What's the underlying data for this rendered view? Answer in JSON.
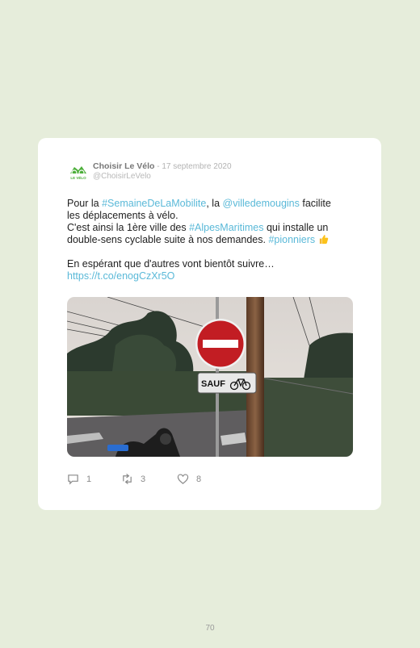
{
  "tweet": {
    "author_name": "Choisir Le Vélo",
    "separator": " - ",
    "date": "17 septembre 2020",
    "handle": "@ChoisirLeVelo",
    "lines": {
      "l1_a": "Pour la ",
      "l1_tag": "#SemaineDeLaMobilite",
      "l1_b": ", la ",
      "l1_mention": "@villedemougins",
      "l1_c": " facilite",
      "l2": "les déplacements à vélo.",
      "l3_a": "C'est ainsi la 1ère ville des ",
      "l3_tag": "#AlpesMaritimes",
      "l3_b": " qui installe un",
      "l4_a": "double-sens cyclable suite à nos demandes. ",
      "l4_tag": "#pionniers",
      "l5": "En espérant que d'autres vont bientôt suivre…",
      "l6_link": "https://t.co/enogCzXr5O"
    },
    "photo_sign_text": "SAUF",
    "replies": "1",
    "retweets": "3",
    "likes": "8"
  },
  "logo_text": "LE VÉLO",
  "page_number": "70",
  "colors": {
    "background": "#e6eddb",
    "link": "#5ab9d8",
    "logo_green": "#4caf3a"
  }
}
